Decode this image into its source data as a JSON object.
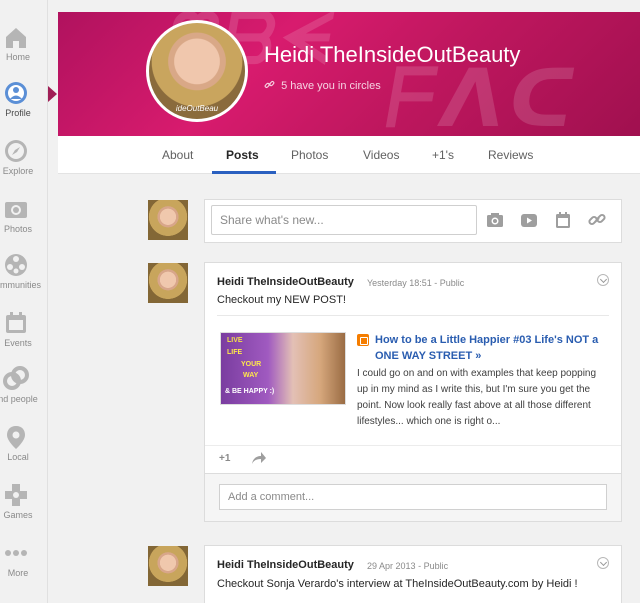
{
  "nav": {
    "items": [
      {
        "label": "Home",
        "icon": "home-icon"
      },
      {
        "label": "Profile",
        "icon": "profile-icon"
      },
      {
        "label": "Explore",
        "icon": "compass-icon"
      },
      {
        "label": "Photos",
        "icon": "camera-icon"
      },
      {
        "label": "ommunities",
        "icon": "communities-icon"
      },
      {
        "label": "Events",
        "icon": "calendar-icon"
      },
      {
        "label": "nd people",
        "icon": "circles-icon"
      },
      {
        "label": "Local",
        "icon": "location-pin-icon"
      },
      {
        "label": "Games",
        "icon": "games-icon"
      },
      {
        "label": "More",
        "icon": "more-dots-icon"
      }
    ]
  },
  "profile": {
    "name": "Heidi TheInsideOutBeauty",
    "circles_text": "5 have you in circles",
    "avatar_caption": "ideOutBeau",
    "accent_color": "#c8186a"
  },
  "tabs": [
    "About",
    "Posts",
    "Photos",
    "Videos",
    "+1's",
    "Reviews"
  ],
  "active_tab": "Posts",
  "share_box": {
    "placeholder": "Share what's new...",
    "icons": [
      "camera-icon",
      "video-icon",
      "event-icon",
      "link-icon"
    ]
  },
  "posts": [
    {
      "author": "Heidi TheInsideOutBeauty",
      "time": "Yesterday 18:51",
      "visibility": "Public",
      "text": "Checkout my NEW POST!",
      "link": {
        "title": "How to be a Little Happier #03 Life's NOT a ONE WAY STREET »",
        "description": "I could go on and on with examples that keep popping up in my mind as I write this, but I'm sure you get the point. Now look really fast above at all those different lifestyles... which one is right o...",
        "thumb_lines": [
          "LIVE",
          "LIFE",
          "YOUR",
          "WAY",
          "& BE HAPPY :)"
        ]
      },
      "plus_one": "+1",
      "comment_placeholder": "Add a comment..."
    },
    {
      "author": "Heidi TheInsideOutBeauty",
      "time": "29 Apr 2013",
      "visibility": "Public",
      "text": "Checkout Sonja Verardo's interview at TheInsideOutBeauty.com by Heidi !"
    }
  ]
}
